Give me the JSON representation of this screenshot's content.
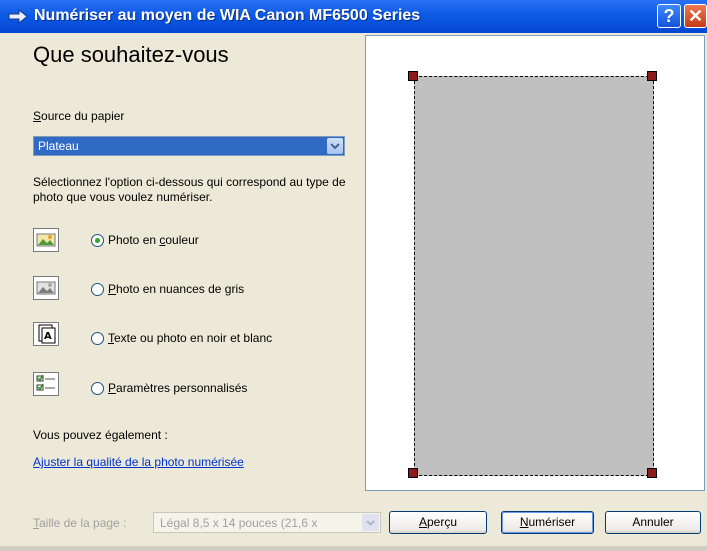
{
  "window": {
    "title": "Numériser au moyen de WIA Canon MF6500 Series",
    "help_glyph": "?",
    "close_glyph": "✕"
  },
  "main": {
    "heading": "Que souhaitez-vous",
    "source": {
      "label_prefix": "S",
      "label_rest": "ource du papier",
      "value": "Plateau"
    },
    "instruction": "Sélectionnez l'option ci-dessous qui correspond au type de photo que vous voulez numériser.",
    "options": [
      {
        "pre": "Photo en ",
        "key": "c",
        "post": "ouleur",
        "selected": true,
        "icon": "color-photo-icon"
      },
      {
        "pre": "",
        "key": "P",
        "post": "hoto en nuances de gris",
        "selected": false,
        "icon": "grayscale-photo-icon"
      },
      {
        "pre": "",
        "key": "T",
        "post": "exte ou photo en noir et blanc",
        "selected": false,
        "icon": "text-bw-icon"
      },
      {
        "pre": "",
        "key": "P",
        "post": "aramètres personnalisés",
        "selected": false,
        "icon": "custom-settings-icon"
      }
    ],
    "also_text": "Vous pouvez également :",
    "adjust_link": "Ajuster la qualité de la photo numérisée"
  },
  "footer": {
    "page_size_label_key": "T",
    "page_size_label_rest": "aille de la page :",
    "page_size_value": "Légal 8,5 x 14 pouces (21,6 x",
    "preview_button": {
      "pre": "",
      "key": "A",
      "post": "perçu"
    },
    "scan_button": {
      "pre": "",
      "key": "N",
      "post": "umériser"
    },
    "cancel_button": "Annuler"
  },
  "colors": {
    "titlebar": "#0d5ae6",
    "selection": "#316ac5",
    "scan_area": "#c0c0c0",
    "handle": "#8b1a1a",
    "radio_dot": "#2fa82f"
  }
}
